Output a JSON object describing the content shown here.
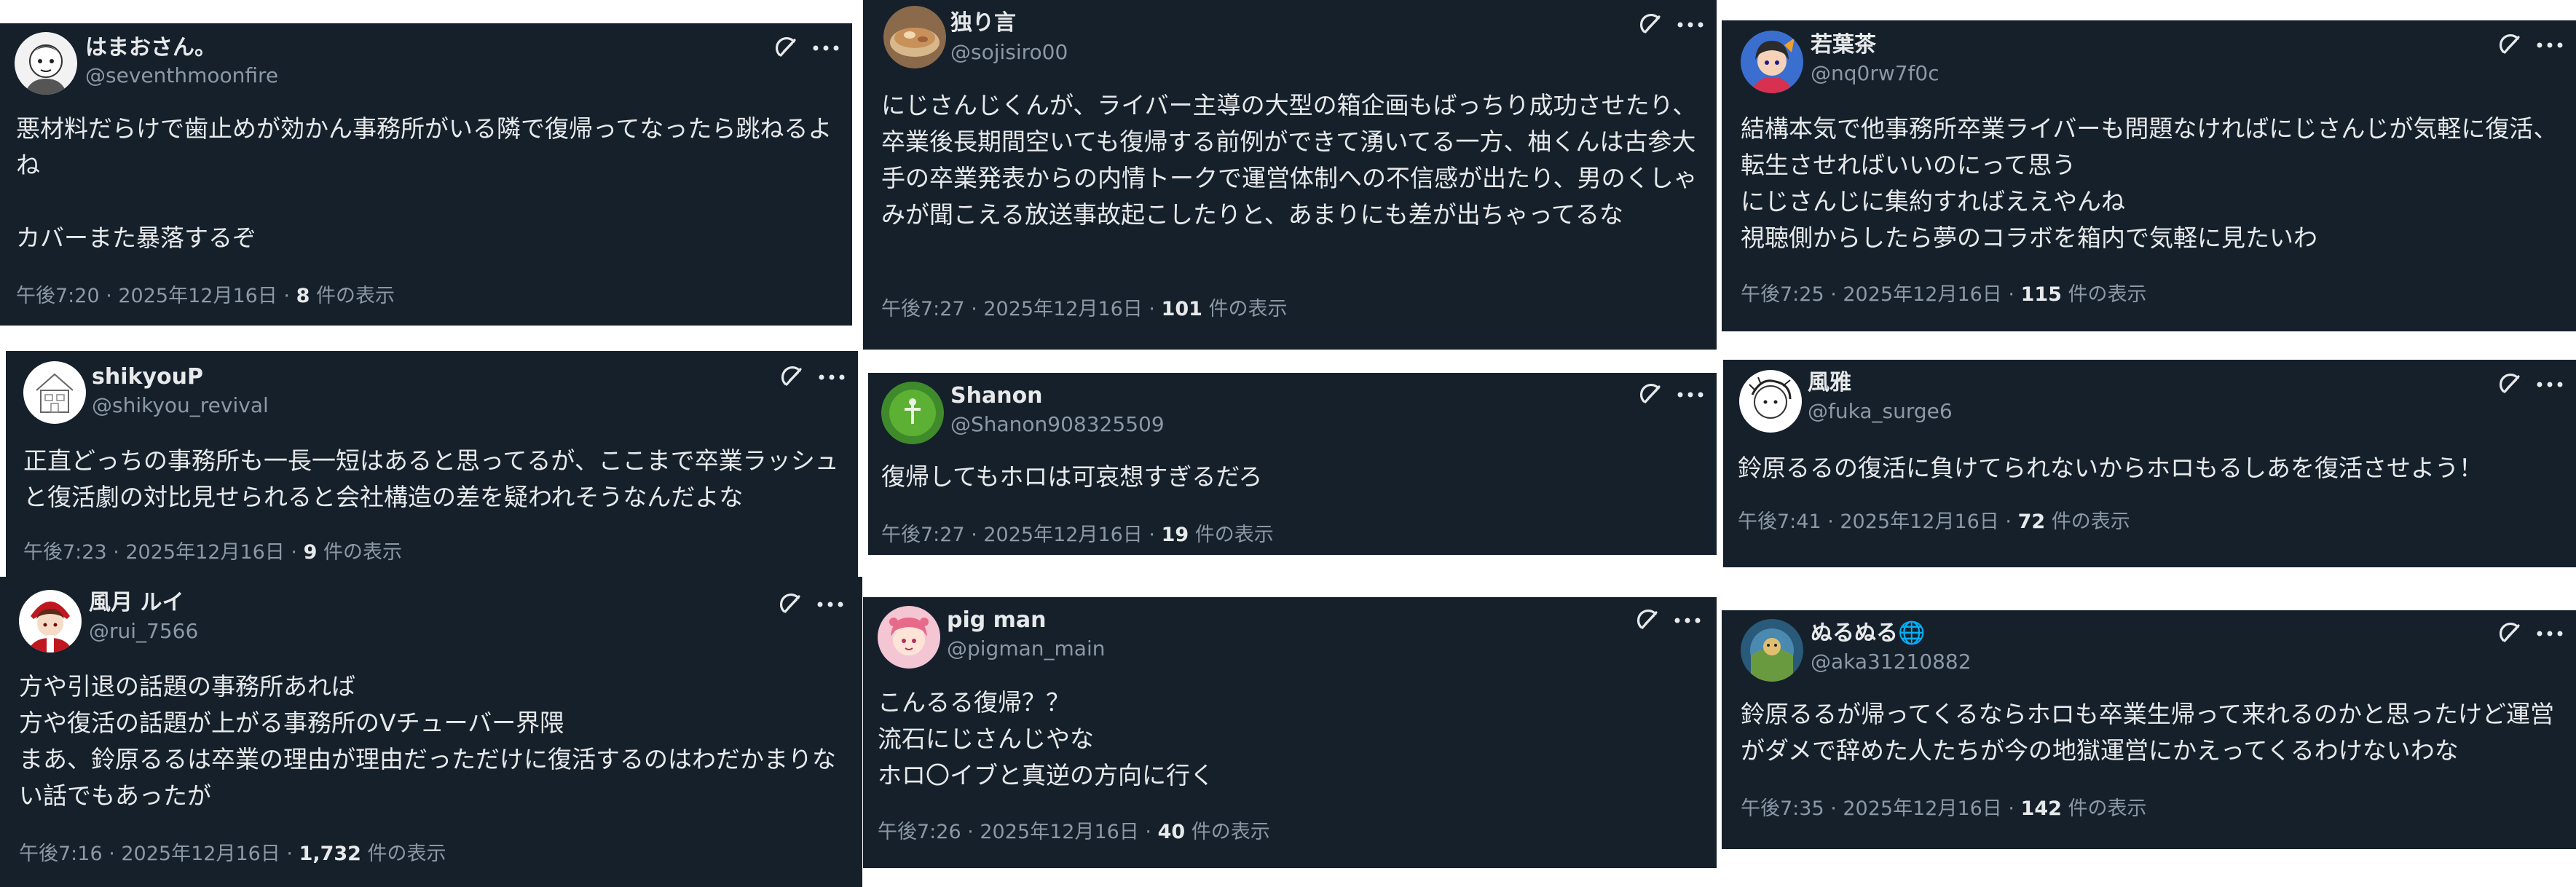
{
  "posts": [
    {
      "name": "はまおさん。",
      "handle": "@seventhmoonfire",
      "text": "悪材料だらけで歯止めが効かん事務所がいる隣で復帰ってなったら跳ねるよね\n\nカバーまた暴落するぞ",
      "time": "午後7:20 · 2025年12月16日 · ",
      "views": "8",
      "views_label": " 件の表示",
      "avatar_icon": "cartoon-avatar"
    },
    {
      "name": "独り言",
      "handle": "@sojisiro00",
      "text": "にじさんじくんが、ライバー主導の大型の箱企画もばっちり成功させたり、卒業後長期間空いても復帰する前例ができて湧いてる一方、柚くんは古参大手の卒業発表からの内情トークで運営体制への不信感が出たり、男のくしゃみが聞こえる放送事故起こしたりと、あまりにも差が出ちゃってるな",
      "time": "午後7:27 · 2025年12月16日 · ",
      "views": "101",
      "views_label": " 件の表示",
      "avatar_icon": "food-avatar"
    },
    {
      "name": "若葉茶",
      "handle": "@nq0rw7f0c",
      "text": "結構本気で他事務所卒業ライバーも問題なければにじさんじが気軽に復活、転生させればいいのにって思う\nにじさんじに集約すればええやんね\n視聴側からしたら夢のコラボを箱内で気軽に見たいわ",
      "time": "午後7:25 · 2025年12月16日 · ",
      "views": "115",
      "views_label": " 件の表示",
      "avatar_icon": "anime-avatar"
    },
    {
      "name": "shikyouP",
      "handle": "@shikyou_revival",
      "text": "正直どっちの事務所も一長一短はあると思ってるが、ここまで卒業ラッシュと復活劇の対比見せられると会社構造の差を疑われそうなんだよな",
      "time": "午後7:23 · 2025年12月16日 · ",
      "views": "9",
      "views_label": " 件の表示",
      "avatar_icon": "house-avatar"
    },
    {
      "name": "Shanon",
      "handle": "@Shanon908325509",
      "text": "復帰してもホロは可哀想すぎるだろ",
      "time": "午後7:27 · 2025年12月16日 · ",
      "views": "19",
      "views_label": " 件の表示",
      "avatar_icon": "green-avatar"
    },
    {
      "name": "風雅",
      "handle": "@fuka_surge6",
      "text": "鈴原るるの復活に負けてられないからホロもるしあを復活させよう！",
      "time": "午後7:41 · 2025年12月16日 · ",
      "views": "72",
      "views_label": " 件の表示",
      "avatar_icon": "sketch-avatar"
    },
    {
      "name": "風月 ルイ",
      "handle": "@rui_7566",
      "text": "方や引退の話題の事務所あれば\n方や復活の話題が上がる事務所のVチューバー界隈\nまあ、鈴原るるは卒業の理由が理由だっただけに復活するのはわだかまりない話でもあったが",
      "time": "午後7:16 · 2025年12月16日 · ",
      "views": "1,732",
      "views_label": " 件の表示",
      "avatar_icon": "shrine-maiden-avatar"
    },
    {
      "name": "pig man",
      "handle": "@pigman_main",
      "text": "こんるる復帰？？\n流石にじさんじやな\nホロ〇イブと真逆の方向に行く",
      "time": "午後7:26 · 2025年12月16日 · ",
      "views": "40",
      "views_label": " 件の表示",
      "avatar_icon": "pink-avatar"
    },
    {
      "name": "ぬるぬる🌐",
      "handle": "@aka31210882",
      "text": "鈴原るるが帰ってくるならホロも卒業生帰って来れるのかと思ったけど運営がダメで辞めた人たちが今の地獄運営にかえってくるわけないわな",
      "time": "午後7:35 · 2025年12月16日 · ",
      "views": "142",
      "views_label": " 件の表示",
      "avatar_icon": "blue-avatar"
    }
  ]
}
